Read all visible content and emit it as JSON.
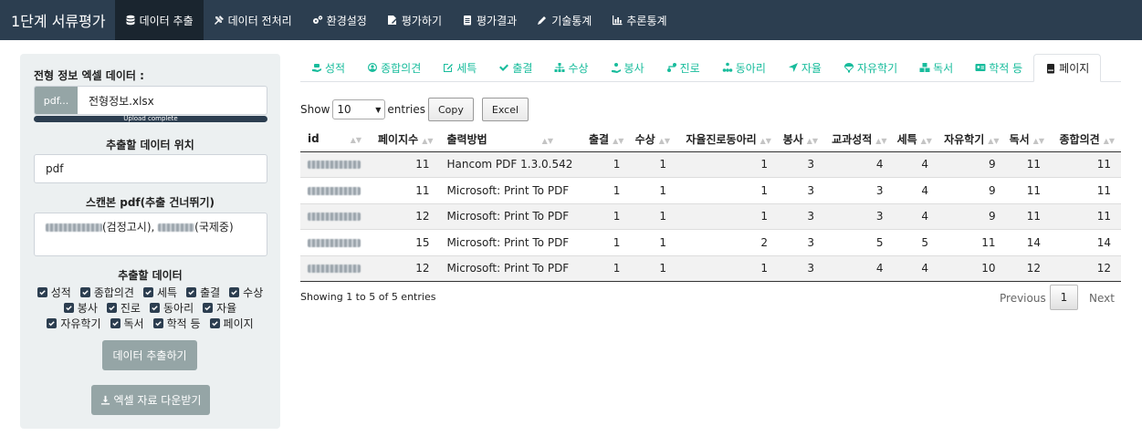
{
  "app": {
    "brand": "1단계 서류평가"
  },
  "navbar": {
    "items": [
      {
        "label": "데이터 추출",
        "icon": "database-icon",
        "active": true
      },
      {
        "label": "데이터 전처리",
        "icon": "tools-icon"
      },
      {
        "label": "환경설정",
        "icon": "cogs-icon"
      },
      {
        "label": "평가하기",
        "icon": "signature-icon"
      },
      {
        "label": "평가결과",
        "icon": "clipboard-list-icon"
      },
      {
        "label": "기술통계",
        "icon": "pen-icon"
      },
      {
        "label": "추론통계",
        "icon": "chart-bar-icon"
      }
    ]
  },
  "sidebar": {
    "file_label": "전형 정보 엑셀 데이터 :",
    "file_button": "pdf...",
    "file_name": "전형정보.xlsx",
    "progress_text": "Upload complete",
    "progress_value": 100,
    "location_label": "추출할 데이터 위치",
    "location_value": "pdf",
    "scan_label": "스캔본 pdf(추출 건너뛰기)",
    "scan_value_a": "(검정고시), ",
    "scan_value_b": "(국제중)",
    "extract_label": "추출할 데이터",
    "checkboxes_row1": [
      "성적",
      "종합의견",
      "세특",
      "출결",
      "수상"
    ],
    "checkboxes_row2": [
      "봉사",
      "진로",
      "동아리",
      "자율"
    ],
    "checkboxes_row3": [
      "자유학기",
      "독서",
      "학적 등",
      "페이지"
    ],
    "extract_button": "데이터 추출하기",
    "download_button": "엑셀 자료 다운받기"
  },
  "tabs": [
    {
      "label": "성적",
      "icon": "hand-holding-icon"
    },
    {
      "label": "종합의견",
      "icon": "user-circle-icon"
    },
    {
      "label": "세특",
      "icon": "edit-icon"
    },
    {
      "label": "출결",
      "icon": "check-icon"
    },
    {
      "label": "수상",
      "icon": "sitemap-icon"
    },
    {
      "label": "봉사",
      "icon": "user-hands-icon"
    },
    {
      "label": "진로",
      "icon": "route-icon"
    },
    {
      "label": "동아리",
      "icon": "network-icon"
    },
    {
      "label": "자율",
      "icon": "location-arrow-icon"
    },
    {
      "label": "자유학기",
      "icon": "parachute-icon"
    },
    {
      "label": "독서",
      "icon": "boxes-icon"
    },
    {
      "label": "학적 등",
      "icon": "id-card-icon"
    },
    {
      "label": "페이지",
      "icon": "book-icon",
      "active": true
    }
  ],
  "table_controls": {
    "show_label": "Show",
    "entries_value": "10",
    "entries_label": "entries",
    "copy_button": "Copy",
    "excel_button": "Excel"
  },
  "table": {
    "headers": [
      "id",
      "페이지수",
      "출력방법",
      "출결",
      "수상",
      "자율진로동아리",
      "봉사",
      "교과성적",
      "세특",
      "자유학기",
      "독서",
      "종합의견"
    ],
    "rows": [
      [
        "",
        "11",
        "Hancom PDF 1.3.0.542",
        "1",
        "1",
        "1",
        "3",
        "4",
        "4",
        "9",
        "11",
        "11"
      ],
      [
        "",
        "11",
        "Microsoft: Print To PDF",
        "1",
        "1",
        "1",
        "3",
        "3",
        "4",
        "9",
        "11",
        "11"
      ],
      [
        "",
        "12",
        "Microsoft: Print To PDF",
        "1",
        "1",
        "1",
        "3",
        "3",
        "4",
        "9",
        "11",
        "11"
      ],
      [
        "",
        "15",
        "Microsoft: Print To PDF",
        "1",
        "1",
        "2",
        "3",
        "5",
        "5",
        "11",
        "14",
        "14"
      ],
      [
        "",
        "12",
        "Microsoft: Print To PDF",
        "1",
        "1",
        "1",
        "3",
        "4",
        "4",
        "10",
        "12",
        "12"
      ]
    ],
    "info": "Showing 1 to 5 of 5 entries",
    "pager": {
      "previous": "Previous",
      "current": "1",
      "next": "Next"
    }
  },
  "colors": {
    "navbar": "#2c3e50",
    "accent": "#18bc9c",
    "sidebar": "#ecf0f1",
    "button": "#95a5a6"
  }
}
